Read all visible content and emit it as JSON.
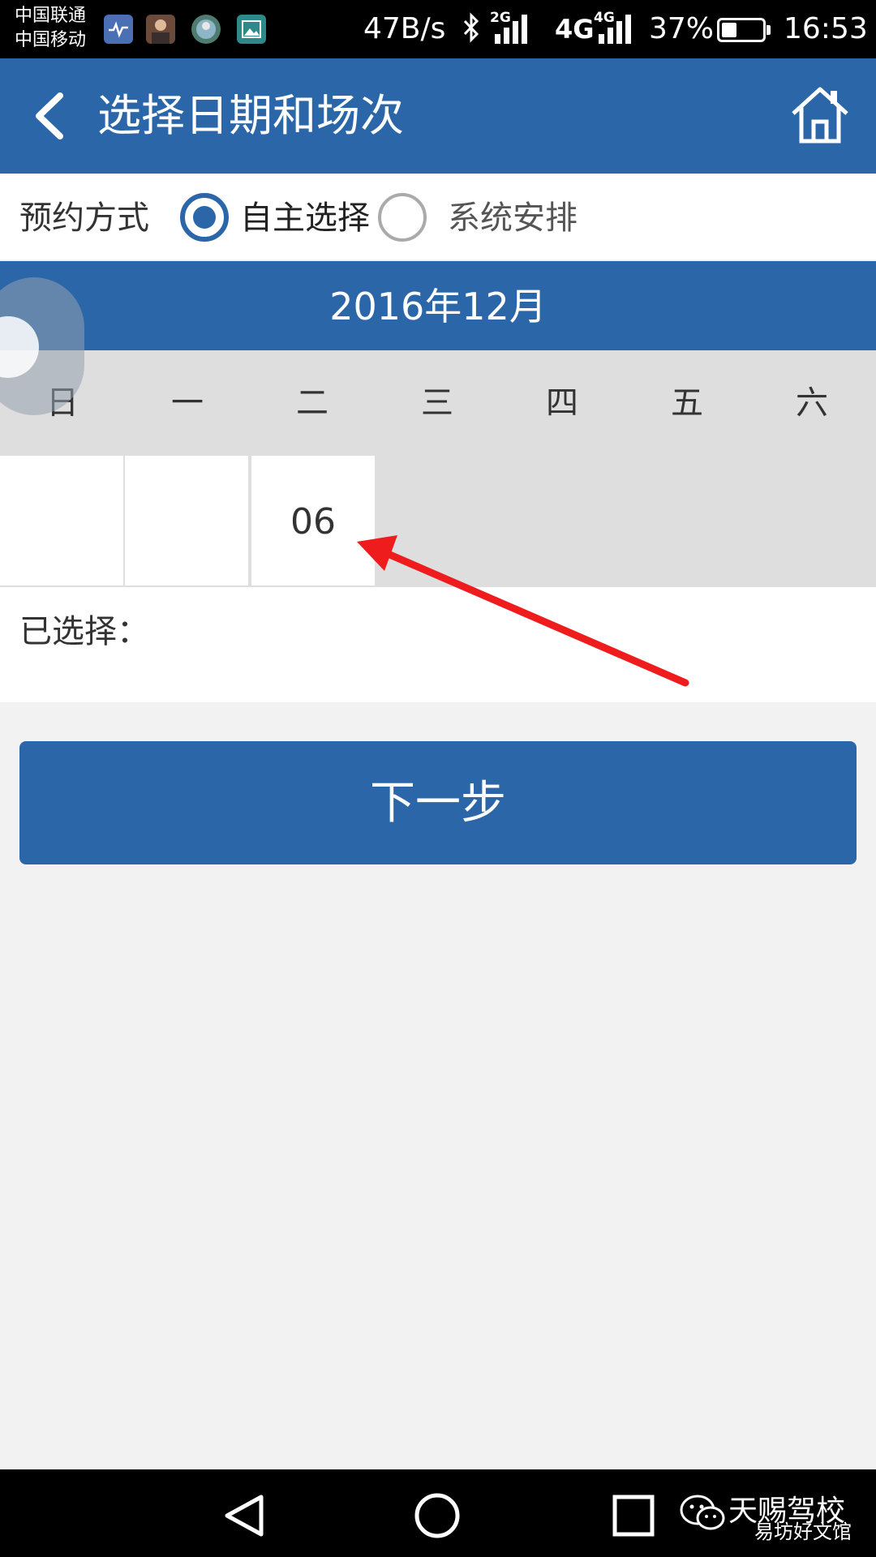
{
  "status_bar": {
    "carrier_1": "中国联通",
    "carrier_2": "中国移动",
    "net_speed": "47B/s",
    "sim1_type": "2G",
    "sim2_type": "4G",
    "sim2_sub": "4G",
    "battery": "37%",
    "battery_level": 0.37,
    "time": "16:53"
  },
  "header": {
    "title": "选择日期和场次",
    "back_icon": "chevron-left-icon",
    "home_icon": "home-icon"
  },
  "booking_mode": {
    "label": "预约方式",
    "options": [
      {
        "label": "自主选择",
        "selected": true
      },
      {
        "label": "系统安排",
        "selected": false
      }
    ]
  },
  "calendar": {
    "month": "2016年12月",
    "weekdays": [
      "日",
      "一",
      "二",
      "三",
      "四",
      "五",
      "六"
    ],
    "days": [
      "",
      "",
      "06"
    ]
  },
  "selected": {
    "label": "已选择："
  },
  "next_button": {
    "label": "下一步"
  },
  "watermark": {
    "line_1": "天赐驾校",
    "line_2": "易坊好文馆"
  },
  "colors": {
    "primary": "#2b66a9",
    "arrow": "#ee1c1c"
  }
}
